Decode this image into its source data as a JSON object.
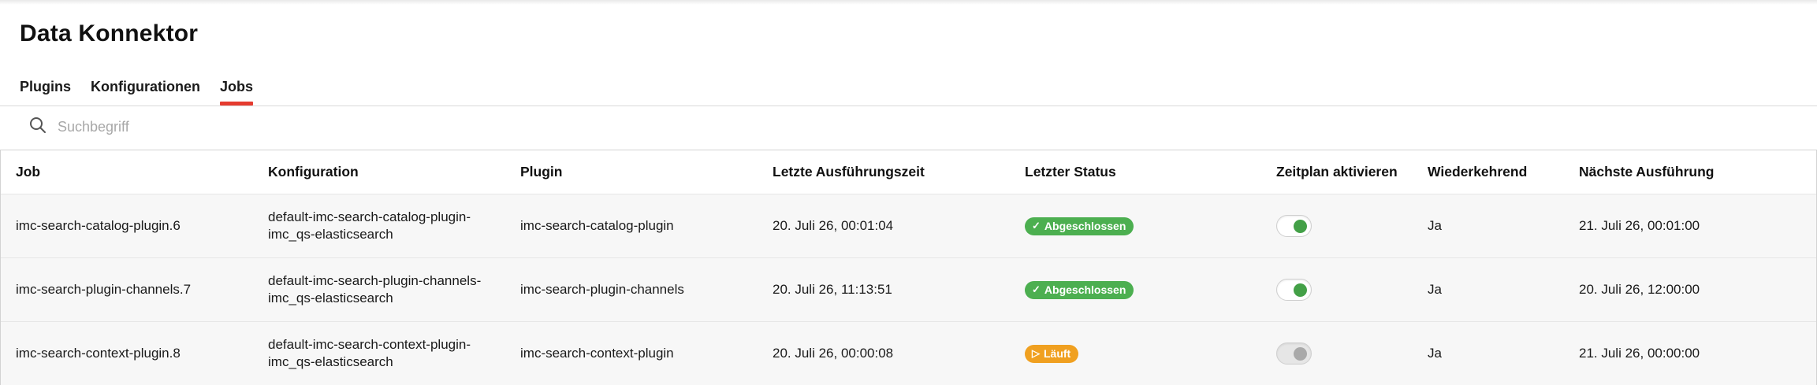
{
  "app": {
    "title": "Data Konnektor"
  },
  "tabs": [
    {
      "label": "Plugins",
      "active": false
    },
    {
      "label": "Konfigurationen",
      "active": false
    },
    {
      "label": "Jobs",
      "active": true
    }
  ],
  "search": {
    "placeholder": "Suchbegriff",
    "value": ""
  },
  "table": {
    "columns": [
      "Job",
      "Konfiguration",
      "Plugin",
      "Letzte Ausführungszeit",
      "Letzter Status",
      "Zeitplan aktivieren",
      "Wiederkehrend",
      "Nächste Ausführung"
    ],
    "rows": [
      {
        "job": "imc-search-catalog-plugin.6",
        "config_line1": "default-imc-search-catalog-plugin-",
        "config_line2": "imc_qs-elasticsearch",
        "plugin": "imc-search-catalog-plugin",
        "last_run": "20. Juli 26, 00:01:04",
        "status": "Abgeschlossen",
        "status_icon": "check-icon",
        "schedule_enabled": true,
        "recurring": "Ja",
        "next_run": "21. Juli 26, 00:01:00"
      },
      {
        "job": "imc-search-plugin-channels.7",
        "config_line1": "default-imc-search-plugin-channels-",
        "config_line2": "imc_qs-elasticsearch",
        "plugin": "imc-search-plugin-channels",
        "last_run": "20. Juli 26, 11:13:51",
        "status": "Abgeschlossen",
        "status_icon": "check-icon",
        "schedule_enabled": true,
        "recurring": "Ja",
        "next_run": "20. Juli 26, 12:00:00"
      },
      {
        "job": "imc-search-context-plugin.8",
        "config_line1": "default-imc-search-context-plugin-",
        "config_line2": "imc_qs-elasticsearch",
        "plugin": "imc-search-context-plugin",
        "last_run": "20. Juli 26, 00:00:08",
        "status": "Läuft",
        "status_icon": "play-icon",
        "schedule_enabled": false,
        "recurring": "Ja",
        "next_run": "21. Juli 26, 00:00:00"
      }
    ]
  },
  "colors": {
    "tab_active_underline": "#e53b2f",
    "status_done": "#4caf50",
    "status_running": "#f0a020",
    "toggle_on": "#43a047",
    "toggle_off": "#a9a9a9"
  },
  "icons": {
    "search": "search-icon",
    "done": "check-icon",
    "running": "play-icon"
  }
}
